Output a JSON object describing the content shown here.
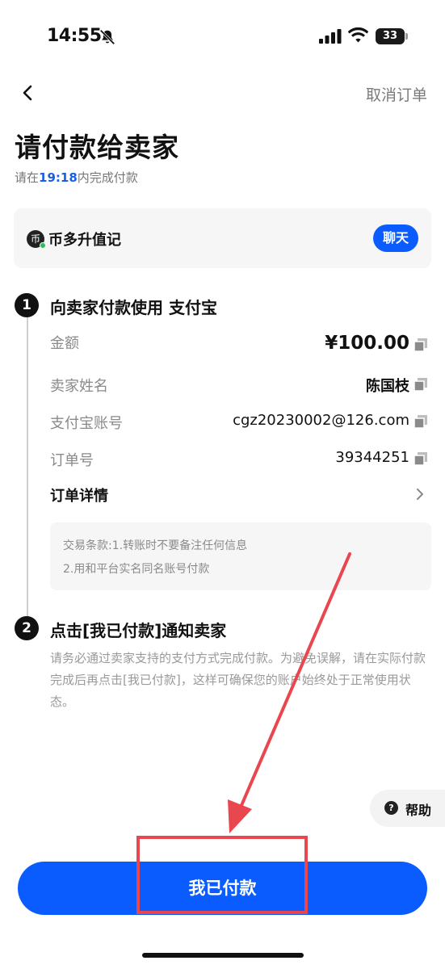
{
  "status_bar": {
    "time": "14:55",
    "battery": "33",
    "icons": [
      "bell-slash-icon",
      "signal-icon",
      "wifi-icon",
      "battery-icon"
    ]
  },
  "nav": {
    "back_icon": "chevron-left-icon",
    "cancel_label": "取消订单"
  },
  "header": {
    "title": "请付款给卖家",
    "countdown_prefix": "请在",
    "countdown_time": "19:18",
    "countdown_suffix": "内完成付款"
  },
  "seller": {
    "avatar_text": "币",
    "name": "币多升值记",
    "chat_label": "聊天"
  },
  "step1": {
    "number": "1",
    "title": "向卖家付款使用 支付宝",
    "rows": [
      {
        "label": "金额",
        "value": "¥100.00"
      },
      {
        "label": "卖家姓名",
        "value": "陈国枝"
      },
      {
        "label": "支付宝账号",
        "value": "cgz20230002@126.com"
      },
      {
        "label": "订单号",
        "value": "39344251"
      }
    ],
    "details_label": "订单详情",
    "terms": {
      "line1": "交易条款:1.转账时不要备注任何信息",
      "line2": "2.用和平台实名同名账号付款"
    }
  },
  "step2": {
    "number": "2",
    "title": "点击[我已付款]通知卖家",
    "description": "请务必通过卖家支持的支付方式完成付款。为避免误解，请在实际付款完成后再点击[我已付款]，这样可确保您的账户始终处于正常使用状态。"
  },
  "help": {
    "icon_text": "?",
    "label": "帮助"
  },
  "footer": {
    "pay_label": "我已付款"
  },
  "colors": {
    "accent": "#0a5cff",
    "annotation": "#e8474f",
    "timer": "#1a5ee6"
  }
}
